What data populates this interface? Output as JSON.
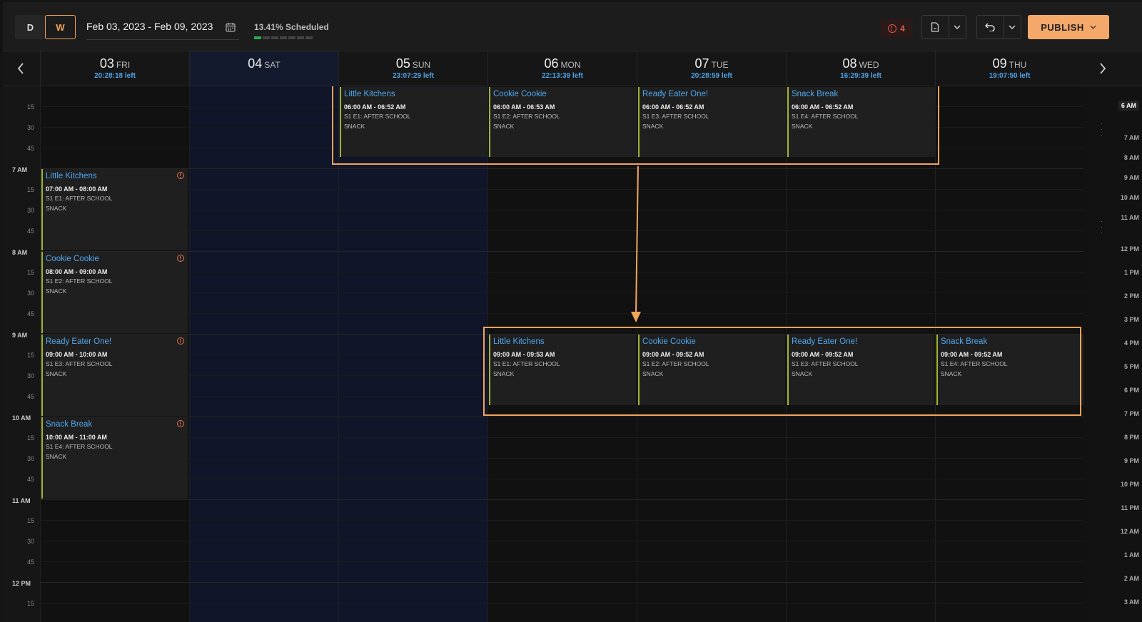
{
  "toolbar": {
    "view_day": "D",
    "view_week": "W",
    "date_range": "Feb 03, 2023 - Feb 09, 2023",
    "scheduled": "13.41% Scheduled",
    "scheduled_fraction": 0.1341,
    "alert_count": "4",
    "publish_label": "PUBLISH",
    "accent_color": "#f2a45c"
  },
  "days": [
    {
      "num": "03",
      "name": "FRI",
      "left": "20:28:18 left"
    },
    {
      "num": "04",
      "name": "SAT",
      "left": ""
    },
    {
      "num": "05",
      "name": "SUN",
      "left": "23:07:29 left"
    },
    {
      "num": "06",
      "name": "MON",
      "left": "22:13:39 left"
    },
    {
      "num": "07",
      "name": "TUE",
      "left": "20:28:59 left"
    },
    {
      "num": "08",
      "name": "WED",
      "left": "16:29:39 left"
    },
    {
      "num": "09",
      "name": "THU",
      "left": "19:07:50 left"
    }
  ],
  "time_labels": {
    "quarters": [
      "15",
      "30",
      "45"
    ],
    "hours": [
      "7 AM",
      "8 AM",
      "9 AM",
      "10 AM",
      "11 AM",
      "12 PM"
    ]
  },
  "right_labels": [
    "6 AM",
    "7 AM",
    "8 AM",
    "9 AM",
    "10 AM",
    "11 AM",
    "12 PM",
    "1 PM",
    "2 PM",
    "3 PM",
    "4 PM",
    "5 PM",
    "6 PM",
    "7 PM",
    "8 PM",
    "9 PM",
    "10 PM",
    "11 PM",
    "12 AM",
    "1 AM",
    "2 AM",
    "3 AM"
  ],
  "shifts_fri": [
    {
      "name": "Little Kitchens",
      "time": "07:00 AM - 08:00 AM",
      "line1": "S1 E1: AFTER SCHOOL",
      "line2": "SNACK"
    },
    {
      "name": "Cookie Cookie",
      "time": "08:00 AM - 09:00 AM",
      "line1": "S1 E2: AFTER SCHOOL",
      "line2": "SNACK"
    },
    {
      "name": "Ready Eater One!",
      "time": "09:00 AM - 10:00 AM",
      "line1": "S1 E3: AFTER SCHOOL",
      "line2": "SNACK"
    },
    {
      "name": "Snack Break",
      "time": "10:00 AM - 11:00 AM",
      "line1": "S1 E4: AFTER SCHOOL",
      "line2": "SNACK"
    }
  ],
  "shifts_early": [
    {
      "name": "Little Kitchens",
      "time": "06:00 AM - 06:52 AM",
      "line1": "S1 E1: AFTER SCHOOL",
      "line2": "SNACK"
    },
    {
      "name": "Cookie Cookie",
      "time": "06:00 AM - 06:53 AM",
      "line1": "S1 E2: AFTER SCHOOL",
      "line2": "SNACK"
    },
    {
      "name": "Ready Eater One!",
      "time": "06:00 AM - 06:52 AM",
      "line1": "S1 E3: AFTER SCHOOL",
      "line2": "SNACK"
    },
    {
      "name": "Snack Break",
      "time": "06:00 AM - 06:52 AM",
      "line1": "S1 E4: AFTER SCHOOL",
      "line2": "SNACK"
    }
  ],
  "shifts_nine": [
    {
      "name": "Little Kitchens",
      "time": "09:00 AM - 09:53 AM",
      "line1": "S1 E1: AFTER SCHOOL",
      "line2": "SNACK"
    },
    {
      "name": "Cookie Cookie",
      "time": "09:00 AM - 09:52 AM",
      "line1": "S1 E2: AFTER SCHOOL",
      "line2": "SNACK"
    },
    {
      "name": "Ready Eater One!",
      "time": "09:00 AM - 09:52 AM",
      "line1": "S1 E3: AFTER SCHOOL",
      "line2": "SNACK"
    },
    {
      "name": "Snack Break",
      "time": "09:00 AM - 09:52 AM",
      "line1": "S1 E4: AFTER SCHOOL",
      "line2": "SNACK"
    }
  ]
}
